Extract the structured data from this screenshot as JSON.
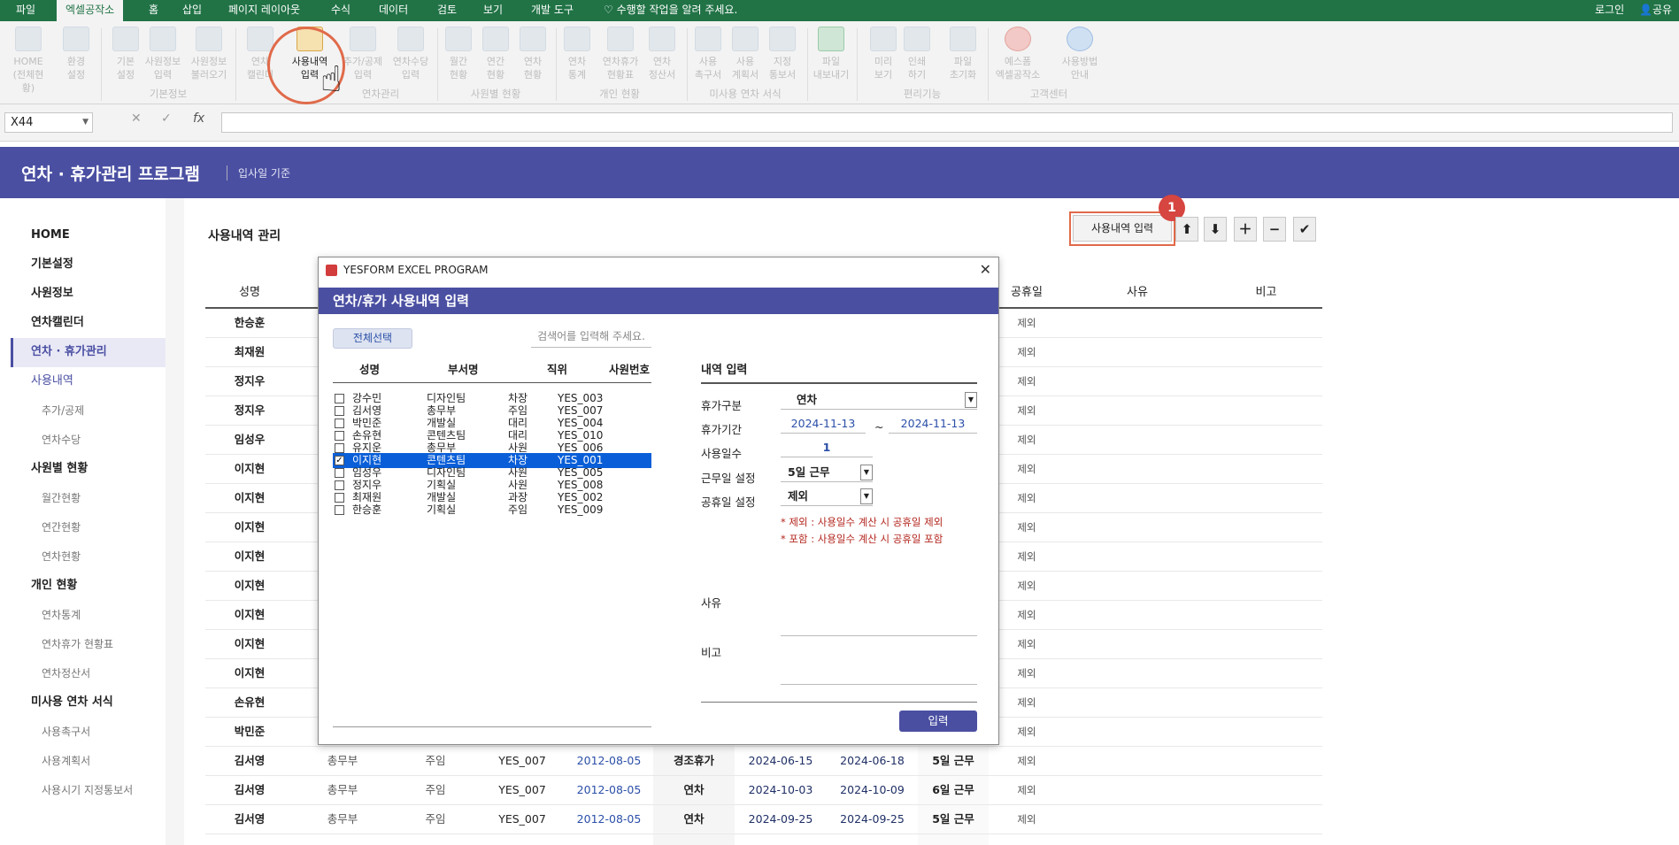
{
  "menubar": {
    "tabs": [
      "파일",
      "엑셀공작소",
      "홈",
      "삽입",
      "페이지 레이아웃",
      "수식",
      "데이터",
      "검토",
      "보기",
      "개발 도구",
      "수행할 작업을 알려 주세요."
    ],
    "login": "로그인",
    "share": "공유"
  },
  "ribbon": {
    "buttons": [
      "HOME\n(전체현황)",
      "환경\n설정",
      "기본\n설정",
      "사원정보\n입력",
      "사원정보\n불러오기",
      "연차\n캘린더",
      "사용내역\n입력",
      "추가/공제\n입력",
      "연차수당\n입력",
      "월간\n현황",
      "연간\n현황",
      "연차\n현황",
      "연차\n통계",
      "연차휴가\n현황표",
      "연차\n정산서",
      "사용\n촉구서",
      "사용\n계획서",
      "지정\n통보서",
      "파일\n내보내기",
      "미리\n보기",
      "인쇄\n하기",
      "파일\n초기화",
      "예스폼\n엑셀공작소",
      "사용방법\n안내"
    ],
    "groups": [
      "기본정보",
      "연차관리",
      "사원별 현황",
      "개인 현황",
      "미사용 연차 서식",
      "편리기능",
      "고객센터"
    ]
  },
  "formula_bar": {
    "name_box": "X44",
    "fx": "fx"
  },
  "banner": {
    "title": "연차 · 휴가관리 프로그램",
    "subtitle": "입사일 기준"
  },
  "sidebar": [
    {
      "label": "HOME",
      "kind": "head"
    },
    {
      "label": "기본설정",
      "kind": "head"
    },
    {
      "label": "사원정보",
      "kind": "head"
    },
    {
      "label": "연차캘린더",
      "kind": "head"
    },
    {
      "label": "연차 · 휴가관리",
      "kind": "active"
    },
    {
      "label": "사용내역",
      "kind": "subactive"
    },
    {
      "label": "추가/공제",
      "kind": "sub"
    },
    {
      "label": "연차수당",
      "kind": "sub"
    },
    {
      "label": "사원별 현황",
      "kind": "head"
    },
    {
      "label": "월간현황",
      "kind": "sub"
    },
    {
      "label": "연간현황",
      "kind": "sub"
    },
    {
      "label": "연차현황",
      "kind": "sub"
    },
    {
      "label": "개인 현황",
      "kind": "head"
    },
    {
      "label": "연차통계",
      "kind": "sub"
    },
    {
      "label": "연차휴가 현황표",
      "kind": "sub"
    },
    {
      "label": "연차정산서",
      "kind": "sub"
    },
    {
      "label": "미사용 연차 서식",
      "kind": "head"
    },
    {
      "label": "사용촉구서",
      "kind": "sub"
    },
    {
      "label": "사용계획서",
      "kind": "sub"
    },
    {
      "label": "사용시기 지정통보서",
      "kind": "sub"
    }
  ],
  "main": {
    "section_title": "사용내역 관리",
    "input_button": "사용내역 입력",
    "step_badge": "1",
    "icon_buttons": [
      "arrow-up-icon",
      "arrow-down-icon",
      "plus-icon",
      "minus-icon",
      "check-icon"
    ],
    "headers": {
      "name": "성명",
      "holiday": "공휴일",
      "reason": "사유",
      "remark": "비고"
    },
    "rows": [
      {
        "name": "한승훈",
        "holiday": "제외"
      },
      {
        "name": "최재원",
        "holiday": "제외"
      },
      {
        "name": "정지우",
        "holiday": "제외"
      },
      {
        "name": "정지우",
        "holiday": "제외"
      },
      {
        "name": "임성우",
        "holiday": "제외"
      },
      {
        "name": "이지현",
        "holiday": "제외"
      },
      {
        "name": "이지현",
        "holiday": "제외"
      },
      {
        "name": "이지현",
        "holiday": "제외"
      },
      {
        "name": "이지현",
        "holiday": "제외"
      },
      {
        "name": "이지현",
        "holiday": "제외"
      },
      {
        "name": "이지현",
        "holiday": "제외"
      },
      {
        "name": "이지현",
        "holiday": "제외"
      },
      {
        "name": "이지현",
        "holiday": "제외"
      },
      {
        "name": "손유현",
        "holiday": "제외"
      },
      {
        "name": "박민준",
        "holiday": "제외"
      },
      {
        "name": "김서영",
        "dept": "총무부",
        "pos": "주임",
        "id": "YES_007",
        "join": "2012-08-05",
        "type": "경조휴가",
        "start": "2024-06-15",
        "end": "2024-06-18",
        "work": "5일 근무",
        "holiday": "제외"
      },
      {
        "name": "김서영",
        "dept": "총무부",
        "pos": "주임",
        "id": "YES_007",
        "join": "2012-08-05",
        "type": "연차",
        "start": "2024-10-03",
        "end": "2024-10-09",
        "work": "6일 근무",
        "holiday": "제외"
      },
      {
        "name": "김서영",
        "dept": "총무부",
        "pos": "주임",
        "id": "YES_007",
        "join": "2012-08-05",
        "type": "연차",
        "start": "2024-09-25",
        "end": "2024-09-25",
        "work": "5일 근무",
        "holiday": "제외"
      }
    ]
  },
  "dialog": {
    "window_title": "YESFORM EXCEL PROGRAM",
    "header": "연차/휴가 사용내역 입력",
    "select_all": "전체선택",
    "search_placeholder": "검색어를 입력해 주세요.",
    "list_headers": [
      "성명",
      "부서명",
      "직위",
      "사원번호"
    ],
    "employees": [
      {
        "name": "강수민",
        "dept": "디자인팀",
        "pos": "차장",
        "id": "YES_003",
        "checked": false
      },
      {
        "name": "김서영",
        "dept": "총무부",
        "pos": "주임",
        "id": "YES_007",
        "checked": false
      },
      {
        "name": "박민준",
        "dept": "개발실",
        "pos": "대리",
        "id": "YES_004",
        "checked": false
      },
      {
        "name": "손유현",
        "dept": "콘텐츠팀",
        "pos": "대리",
        "id": "YES_010",
        "checked": false
      },
      {
        "name": "유지운",
        "dept": "총무부",
        "pos": "사원",
        "id": "YES_006",
        "checked": false
      },
      {
        "name": "이지현",
        "dept": "콘텐츠팀",
        "pos": "차장",
        "id": "YES_001",
        "checked": true
      },
      {
        "name": "임성우",
        "dept": "디자인팀",
        "pos": "사원",
        "id": "YES_005",
        "checked": false
      },
      {
        "name": "정지우",
        "dept": "기획실",
        "pos": "사원",
        "id": "YES_008",
        "checked": false
      },
      {
        "name": "최재원",
        "dept": "개발실",
        "pos": "과장",
        "id": "YES_002",
        "checked": false
      },
      {
        "name": "한승훈",
        "dept": "기획실",
        "pos": "주임",
        "id": "YES_009",
        "checked": false
      }
    ],
    "form": {
      "title": "내역 입력",
      "leave_type_label": "휴가구분",
      "leave_type": "연차",
      "period_label": "휴가기간",
      "period_start": "2024-11-13",
      "period_sep": "~",
      "period_end": "2024-11-13",
      "days_label": "사용일수",
      "days": "1",
      "workday_label": "근무일 설정",
      "workday": "5일 근무",
      "holiday_label": "공휴일 설정",
      "holiday": "제외",
      "note1": "* 제외 : 사용일수 계산 시 공휴일 제외",
      "note2": "* 포함 : 사용일수 계산 시 공휴일 포함",
      "reason_label": "사유",
      "remark_label": "비고",
      "submit": "입력"
    }
  },
  "colors": {
    "excel_green": "#217346",
    "brand": "#4a4fa2",
    "highlight": "#e06a4a",
    "selection": "#0a5fd8"
  }
}
